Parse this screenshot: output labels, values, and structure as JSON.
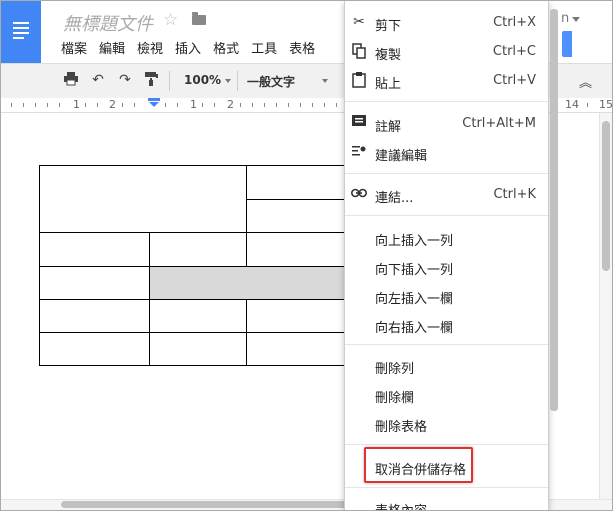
{
  "header": {
    "title": "無標題文件",
    "star_glyph": "☆",
    "menus": [
      "檔案",
      "編輯",
      "檢視",
      "插入",
      "格式",
      "工具",
      "表格"
    ],
    "user_fragment": "n"
  },
  "toolbar": {
    "zoom": "100%",
    "style": "一般文字",
    "icons": [
      "print-icon",
      "undo-icon",
      "redo-icon",
      "paint-format-icon",
      "collapse-icon"
    ]
  },
  "ruler": {
    "labels": [
      "1",
      "2",
      "1",
      "2",
      "14",
      "15"
    ]
  },
  "context_menu": {
    "items": [
      {
        "label": "剪下",
        "shortcut": "Ctrl+X",
        "icon": "scissors-icon"
      },
      {
        "label": "複製",
        "shortcut": "Ctrl+C",
        "icon": "copy-icon"
      },
      {
        "label": "貼上",
        "shortcut": "Ctrl+V",
        "icon": "paste-icon"
      },
      {
        "label": "註解",
        "shortcut": "Ctrl+Alt+M",
        "icon": "comment-icon"
      },
      {
        "label": "建議編輯",
        "shortcut": "",
        "icon": "suggest-edit-icon"
      },
      {
        "label": "連結...",
        "shortcut": "Ctrl+K",
        "icon": "link-icon"
      },
      {
        "label": "向上插入一列",
        "shortcut": "",
        "icon": ""
      },
      {
        "label": "向下插入一列",
        "shortcut": "",
        "icon": ""
      },
      {
        "label": "向左插入一欄",
        "shortcut": "",
        "icon": ""
      },
      {
        "label": "向右插入一欄",
        "shortcut": "",
        "icon": ""
      },
      {
        "label": "刪除列",
        "shortcut": "",
        "icon": ""
      },
      {
        "label": "刪除欄",
        "shortcut": "",
        "icon": ""
      },
      {
        "label": "刪除表格",
        "shortcut": "",
        "icon": ""
      },
      {
        "label": "取消合併儲存格",
        "shortcut": "",
        "icon": ""
      },
      {
        "label": "表格內容...",
        "shortcut": "",
        "icon": ""
      }
    ],
    "highlighted_item": "取消合併儲存格",
    "highlight_color": "#e03030"
  },
  "colors": {
    "brand_blue": "#4285f4",
    "selected_cell": "#d9d9d9"
  }
}
